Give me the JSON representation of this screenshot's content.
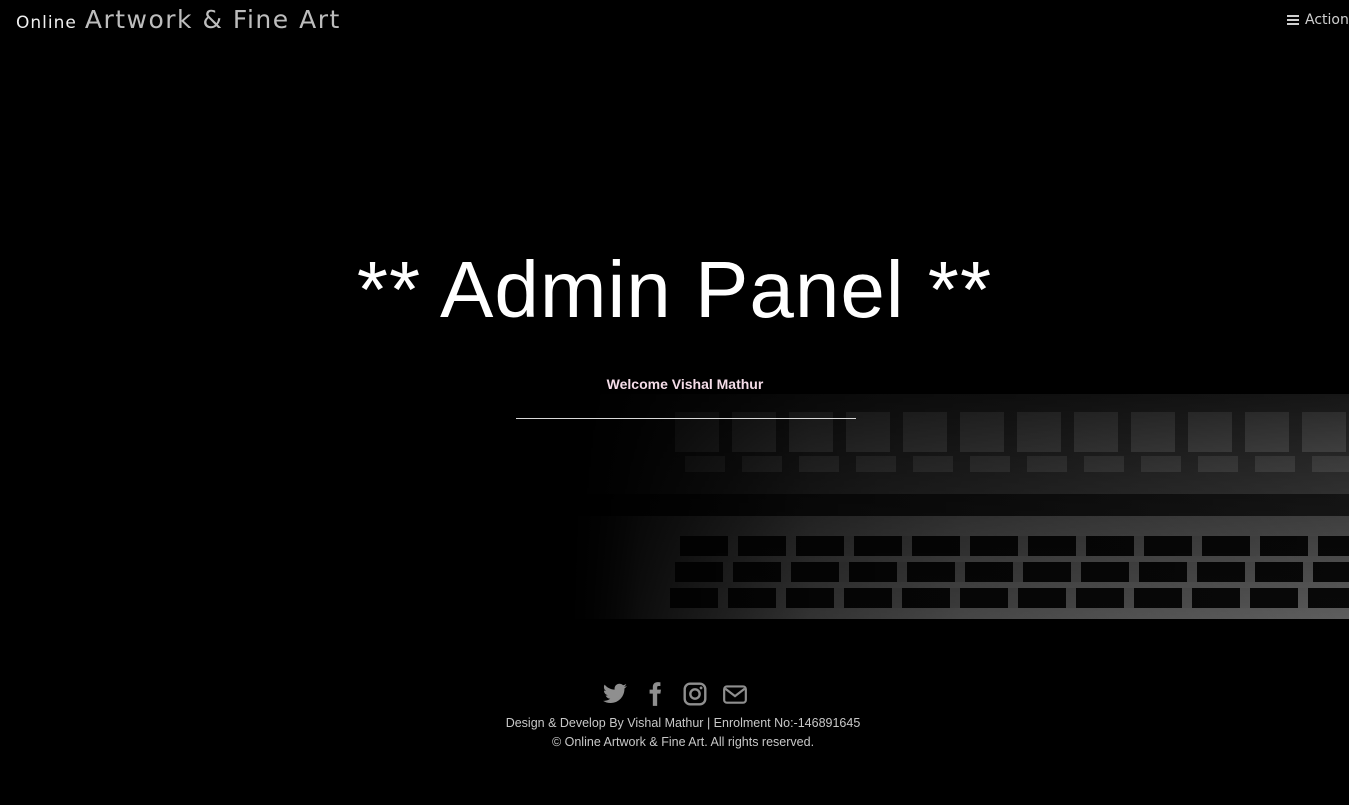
{
  "navbar": {
    "brand_small": "Online",
    "brand_big": "Artwork & Fine Art",
    "action_label": "Action",
    "action_icon": "hamburger-menu-icon"
  },
  "hero": {
    "title": "** Admin Panel **",
    "welcome": "Welcome Vishal Mathur"
  },
  "footer": {
    "social": [
      {
        "name": "twitter-icon"
      },
      {
        "name": "facebook-icon"
      },
      {
        "name": "instagram-icon"
      },
      {
        "name": "email-icon"
      }
    ],
    "credit": "Design & Develop By Vishal Mathur | Enrolment No:-146891645",
    "copyright": "© Online Artwork & Fine Art. All rights reserved."
  },
  "colors": {
    "background": "#000000",
    "text": "#ffffff",
    "welcome_text": "#f4dce8",
    "icon": "#8f8f8f"
  }
}
